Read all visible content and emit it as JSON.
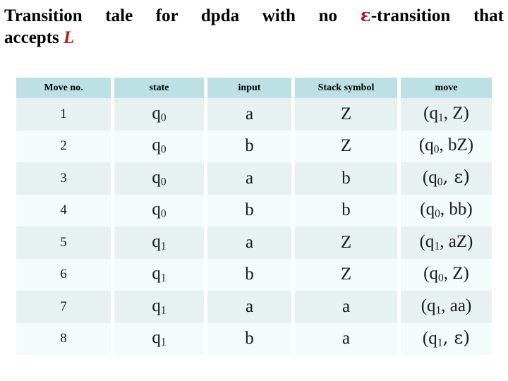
{
  "title": {
    "line1_before_accent": "Transition tale for dpda with no ",
    "accent_symbol": "ε",
    "line1_after_accent": "-transition that",
    "line2_text": "accepts ",
    "line2_accent": "L",
    "full_text": "Transition tale for dpda with no ε-transition that accepts L",
    "accent_color": "#b01c1c",
    "text_color": "#000000"
  },
  "table": {
    "header_background": "#bde0e4",
    "row_odd_background": "#e7f1f2",
    "row_even_background": "#f5fafb",
    "columns": [
      "Move no.",
      "state",
      "input",
      "Stack symbol",
      "move"
    ],
    "rows": [
      {
        "move_no": "1",
        "state": "q",
        "state_sub": "0",
        "input": "a",
        "stack_symbol": "Z",
        "move_open": "(q",
        "move_sub": "1",
        "move_rest": ", Z)"
      },
      {
        "move_no": "2",
        "state": "q",
        "state_sub": "0",
        "input": "b",
        "stack_symbol": "Z",
        "move_open": "(q",
        "move_sub": "0",
        "move_rest": ", bZ)"
      },
      {
        "move_no": "3",
        "state": "q",
        "state_sub": "0",
        "input": "a",
        "stack_symbol": "b",
        "move_open": "(q",
        "move_sub": "0",
        "move_rest": ", ε)"
      },
      {
        "move_no": "4",
        "state": "q",
        "state_sub": "0",
        "input": "b",
        "stack_symbol": "b",
        "move_open": "(q",
        "move_sub": "0",
        "move_rest": ", bb)"
      },
      {
        "move_no": "5",
        "state": "q",
        "state_sub": "1",
        "input": "a",
        "stack_symbol": "Z",
        "move_open": "(q",
        "move_sub": "1",
        "move_rest": ", aZ)"
      },
      {
        "move_no": "6",
        "state": "q",
        "state_sub": "1",
        "input": "b",
        "stack_symbol": "Z",
        "move_open": "(q",
        "move_sub": "0",
        "move_rest": ", Z)"
      },
      {
        "move_no": "7",
        "state": "q",
        "state_sub": "1",
        "input": "a",
        "stack_symbol": "a",
        "move_open": "(q",
        "move_sub": "1",
        "move_rest": ", aa)"
      },
      {
        "move_no": "8",
        "state": "q",
        "state_sub": "1",
        "input": "b",
        "stack_symbol": "a",
        "move_open": "(q",
        "move_sub": "1",
        "move_rest": ", ε)"
      }
    ]
  }
}
